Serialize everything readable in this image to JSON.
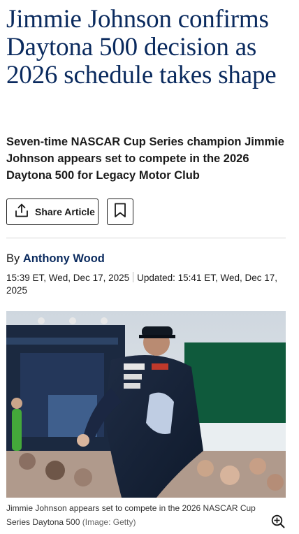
{
  "article": {
    "headline": "Jimmie Johnson confirms Daytona 500 decision as 2026 schedule takes shape",
    "standfirst": "Seven-time NASCAR Cup Series champion Jimmie Johnson appears set to compete in the 2026 Daytona 500 for Legacy Motor Club",
    "share_label": "Share Article",
    "byline_prefix": "By",
    "author": "Anthony Wood",
    "published": "15:39 ET, Wed, Dec 17, 2025",
    "updated": "Updated: 15:41 ET, Wed, Dec 17, 2025"
  },
  "image": {
    "caption": "Jimmie Johnson appears set to compete in the 2026 NASCAR Cup Series Daytona 500",
    "credit": "(Image: Getty)"
  },
  "icons": {
    "share": "share-icon",
    "save": "bookmark-icon",
    "zoom": "zoom-in-icon"
  },
  "colors": {
    "headline": "#0a2a5e",
    "author_link": "#0a2a5e",
    "text": "#1a1a1a"
  }
}
